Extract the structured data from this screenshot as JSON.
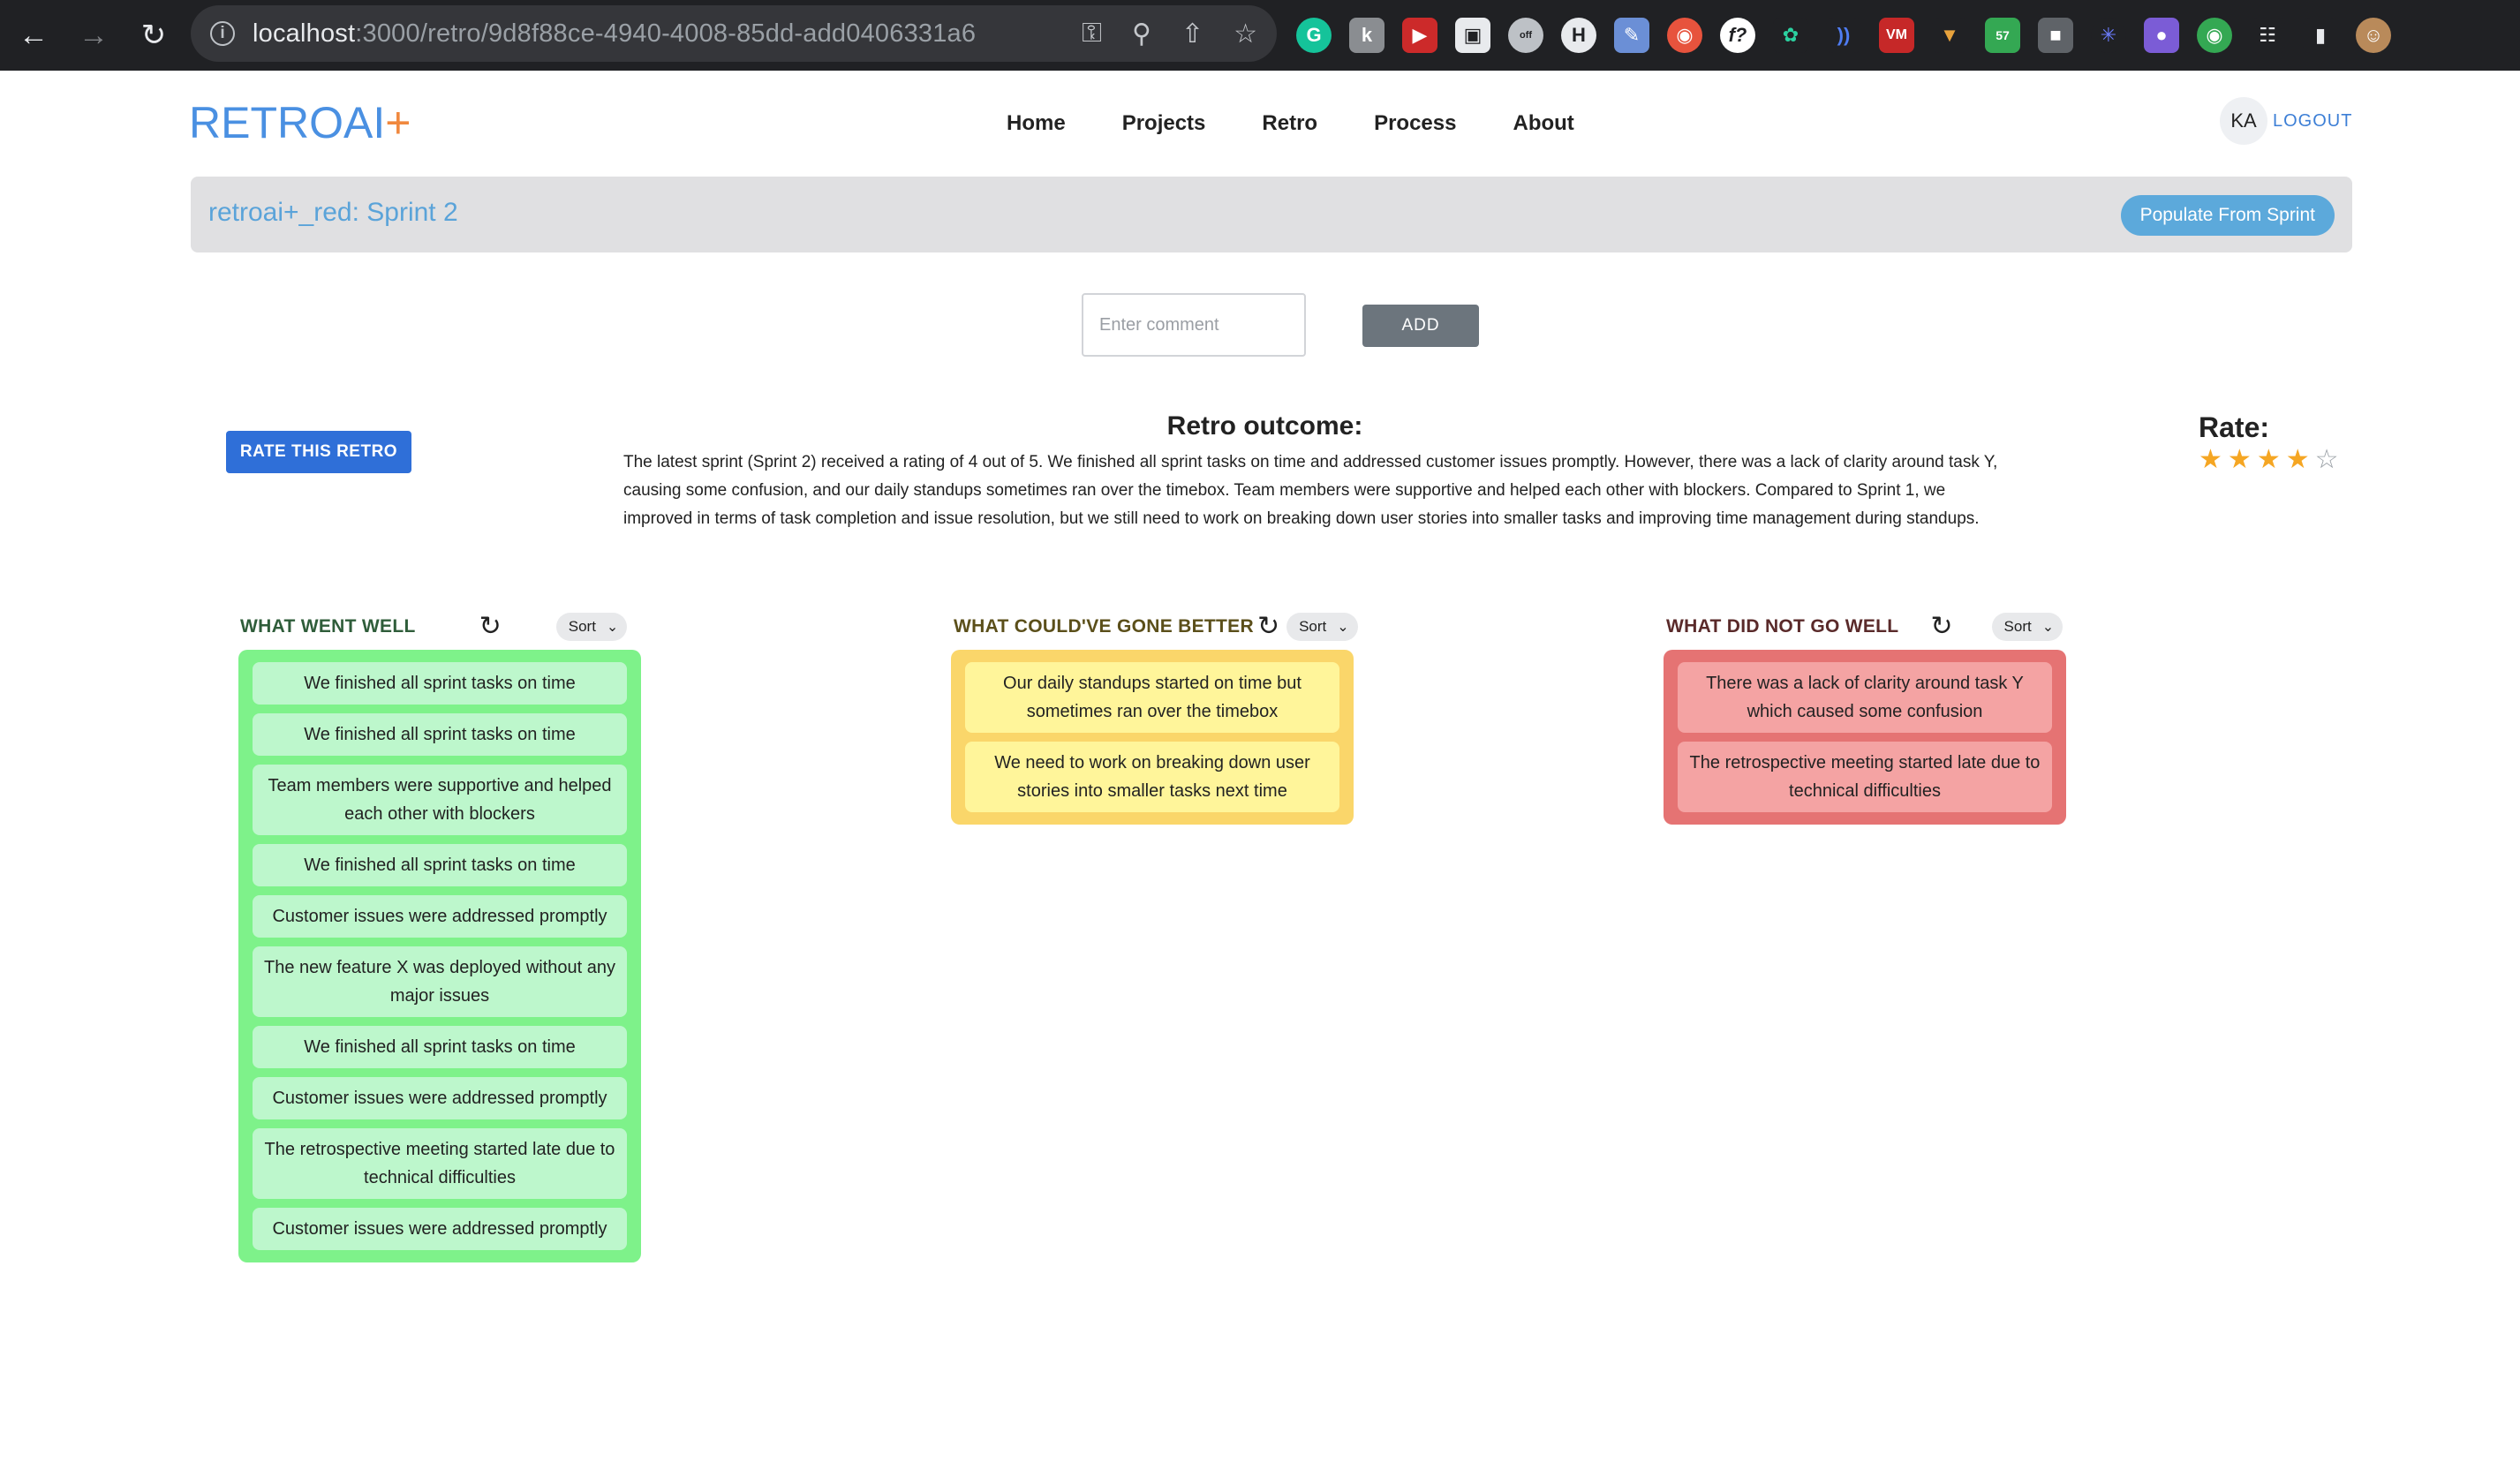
{
  "browser": {
    "url_host": "localhost",
    "url_path": ":3000/retro/9d8f88ce-4940-4008-85dd-add0406331a6",
    "extension_badge": "57",
    "extension_badge_off": "off"
  },
  "app": {
    "logo_main": "RETROAI",
    "logo_plus": "+",
    "nav": [
      "Home",
      "Projects",
      "Retro",
      "Process",
      "About"
    ],
    "user_initials": "KA",
    "logout_label": "LOGOUT"
  },
  "banner": {
    "title": "retroai+_red: Sprint 2",
    "populate_label": "Populate From Sprint"
  },
  "comment": {
    "placeholder": "Enter comment",
    "add_label": "ADD"
  },
  "outcome": {
    "rate_button_label": "RATE THIS RETRO",
    "title": "Retro outcome:",
    "text": "The latest sprint (Sprint 2) received a rating of 4 out of 5. We finished all sprint tasks on time and addressed customer issues promptly. However, there was a lack of clarity around task Y, causing some confusion, and our daily standups sometimes ran over the timebox. Team members were supportive and helped each other with blockers. Compared to Sprint 1, we improved in terms of task completion and issue resolution, but we still need to work on breaking down user stories into smaller tasks and improving time management during standups.",
    "rate_label": "Rate:",
    "rating": 4,
    "rating_max": 5
  },
  "columns": {
    "sort_label": "Sort",
    "went_well": {
      "title": "WHAT WENT WELL",
      "color": "#2f5d3a",
      "cards": [
        "We finished all sprint tasks on time",
        "We finished all sprint tasks on time",
        "Team members were supportive and helped each other with blockers",
        "We finished all sprint tasks on time",
        "Customer issues were addressed promptly",
        "The new feature X was deployed without any major issues",
        "We finished all sprint tasks on time",
        "Customer issues were addressed promptly",
        "The retrospective meeting started late due to technical difficulties",
        "Customer issues were addressed promptly"
      ]
    },
    "could_be_better": {
      "title": "WHAT COULD'VE GONE BETTER",
      "color": "#5b4f1a",
      "cards": [
        "Our daily standups started on time but sometimes ran over the timebox",
        "We need to work on breaking down user stories into smaller tasks next time"
      ]
    },
    "did_not_go_well": {
      "title": "WHAT DID NOT GO WELL",
      "color": "#5a2a2a",
      "cards": [
        "There was a lack of clarity around task Y which caused some confusion",
        "The retrospective meeting started late due to technical difficulties"
      ]
    }
  }
}
